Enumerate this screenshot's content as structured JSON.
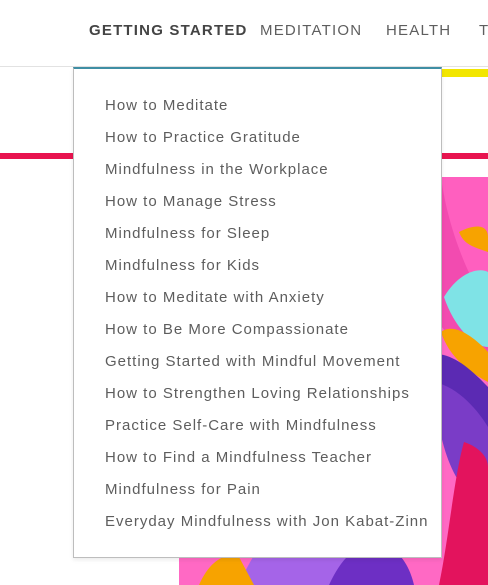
{
  "nav": {
    "items": [
      "GETTING STARTED",
      "MEDITATION",
      "HEALTH",
      "T"
    ]
  },
  "dropdown": {
    "items": [
      "How to Meditate",
      "How to Practice Gratitude",
      "Mindfulness in the Workplace",
      "How to Manage Stress",
      "Mindfulness for Sleep",
      "Mindfulness for Kids",
      "How to Meditate with Anxiety",
      "How to Be More Compassionate",
      "Getting Started with Mindful Movement",
      "How to Strengthen Loving Relationships",
      "Practice Self-Care with Mindfulness",
      "How to Find a Mindfulness Teacher",
      "Mindfulness for Pain",
      "Everyday Mindfulness with Jon Kabat-Zinn"
    ]
  },
  "colors": {
    "accent_line": "#e8144f",
    "highlight": "#f2e600",
    "dropdown_top_border": "#3f8ea4"
  }
}
